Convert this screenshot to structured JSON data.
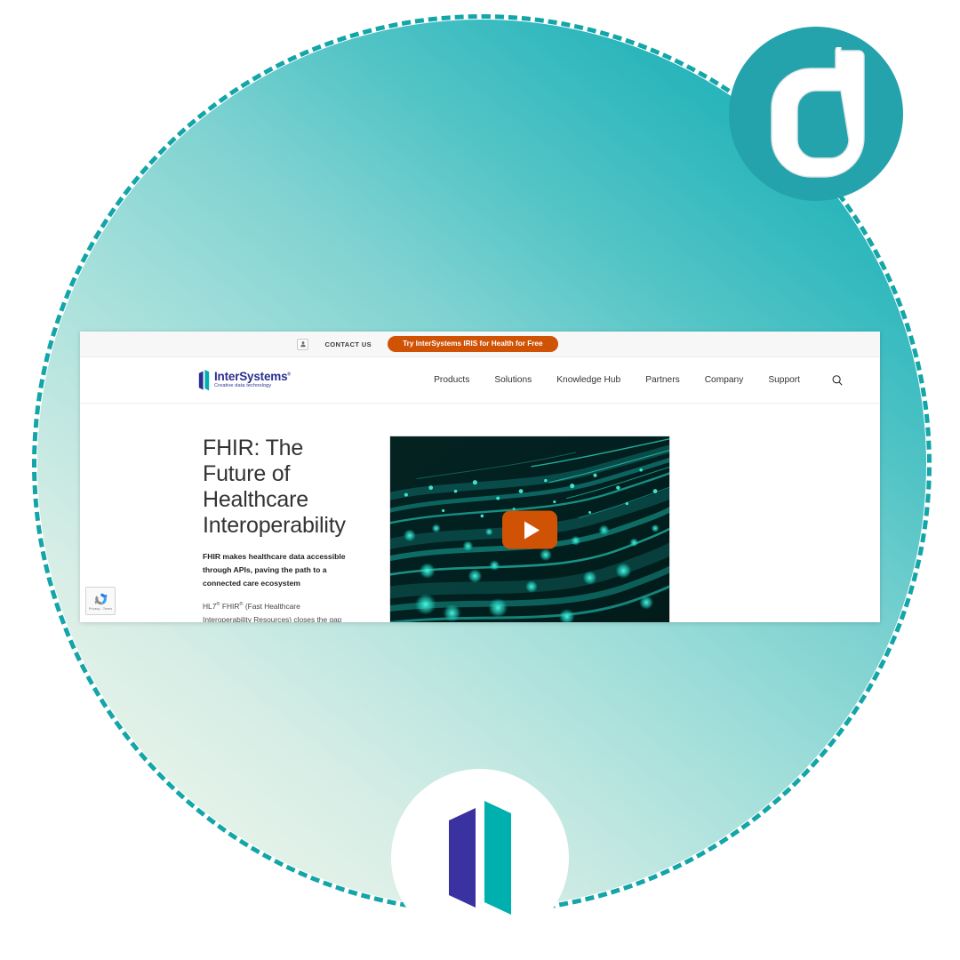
{
  "background": {
    "disc_gradient_from": "#f2f7ec",
    "disc_gradient_to": "#12a9b2",
    "dash_color": "#14a5a8"
  },
  "badges": {
    "letter_badge": {
      "letter": "d",
      "bg_color": "#25a3ad",
      "letter_color": "#ffffff"
    },
    "door_badge": {
      "name": "intersystems-door-mark",
      "color_left": "#3a32a0",
      "color_right": "#00b0ae"
    }
  },
  "browser": {
    "utility_bar": {
      "account_icon": "user-icon",
      "contact_label": "CONTACT US",
      "cta_label": "Try InterSystems IRIS for Health for Free",
      "cta_color": "#cf5205"
    },
    "header": {
      "logo": {
        "name": "InterSystems",
        "trademark": "®",
        "tagline": "Creative data technology",
        "color": "#2b2f8f",
        "mark": "door-icon"
      },
      "nav": [
        {
          "label": "Products"
        },
        {
          "label": "Solutions"
        },
        {
          "label": "Knowledge Hub"
        },
        {
          "label": "Partners"
        },
        {
          "label": "Company"
        },
        {
          "label": "Support"
        }
      ],
      "search_icon": "search-icon"
    },
    "hero": {
      "title": "FHIR: The Future of Healthcare Interoperability",
      "subtitle_line1": "FHIR makes healthcare data accessible",
      "subtitle_line2": "through APIs, paving the path to a connected care ecosystem",
      "body_pre": "HL7",
      "body_sup1": "®",
      "body_mid": " FHIR",
      "body_sup2": "®",
      "body_rest": " (Fast Healthcare Interoperability Resources) closes the gap between the explosion of healthcare data and our ability to make that data accessible, computable, and usable to improve outcomes."
    },
    "video": {
      "name": "fhir-overview-video",
      "play_button": "play-icon",
      "play_color": "#cf5205",
      "thumbnail_description": "teal fiber optic light streams with glowing dots on dark background"
    },
    "recaptcha": {
      "line1": "Privacy",
      "separator": "-",
      "line2": "Terms"
    }
  }
}
